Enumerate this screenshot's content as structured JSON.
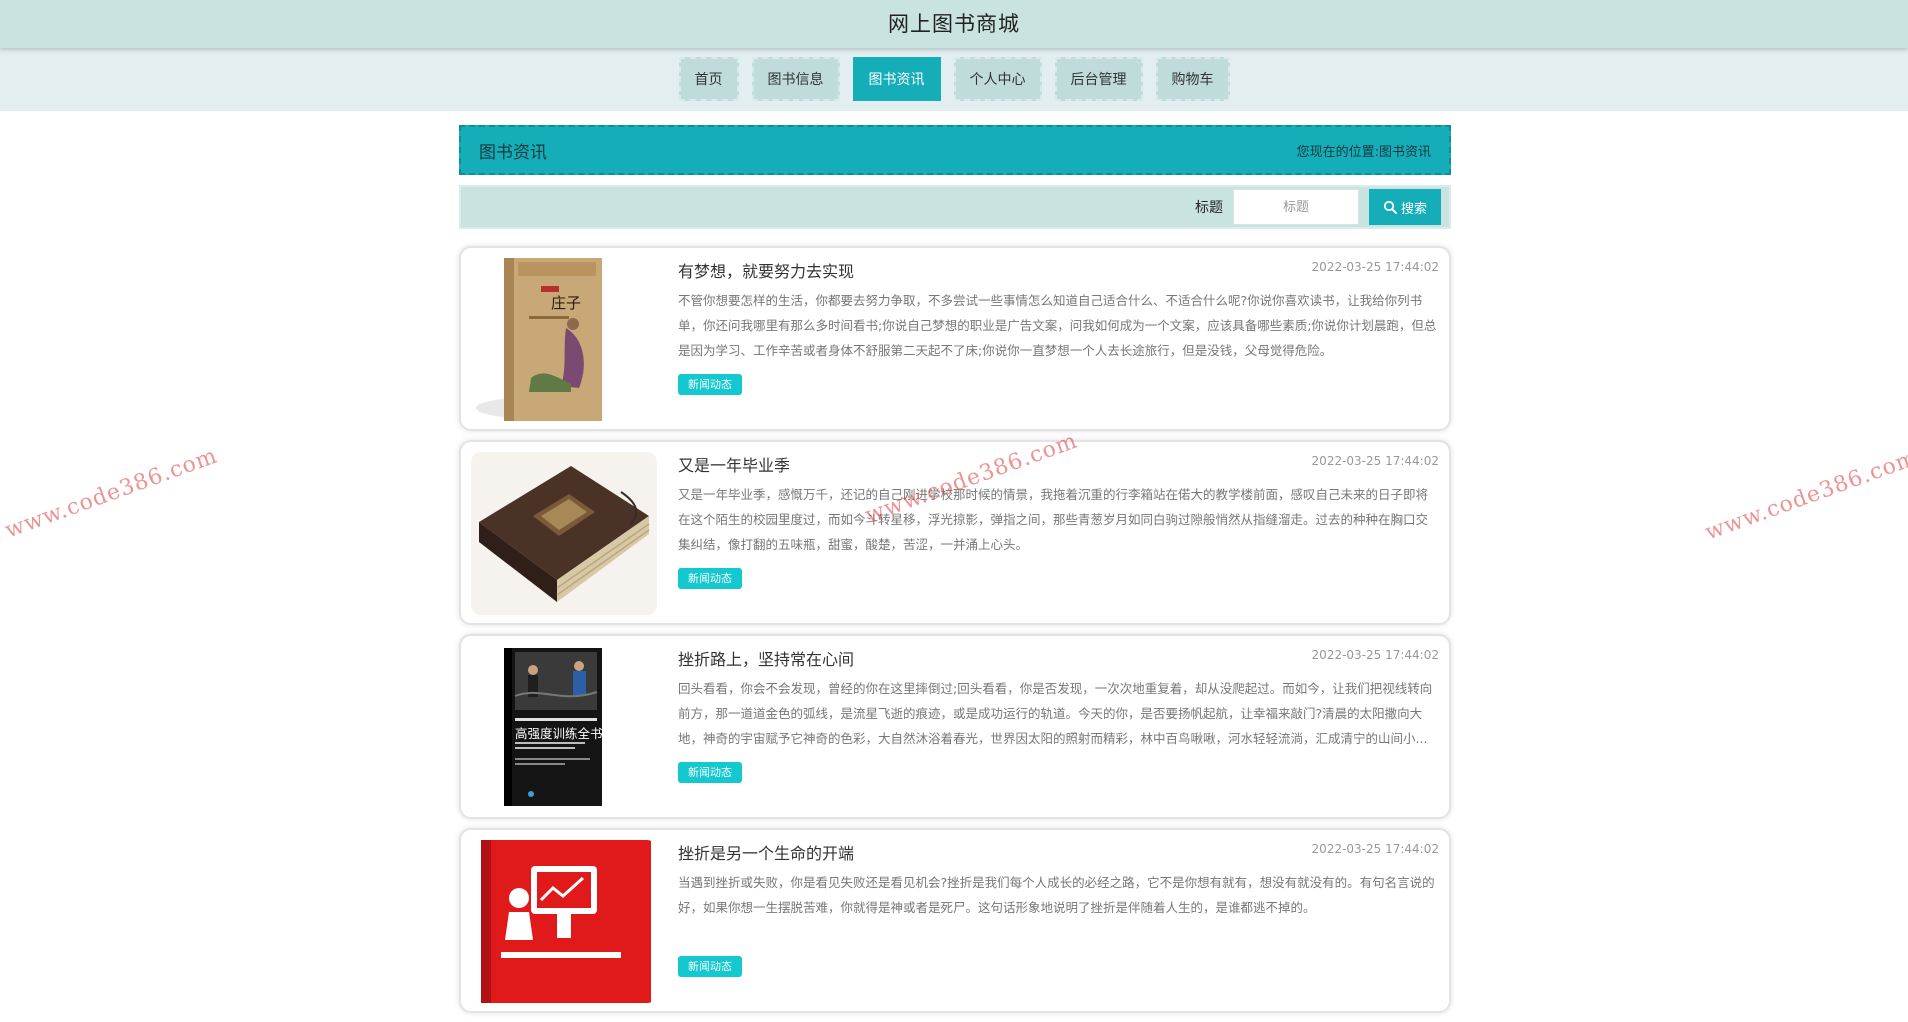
{
  "header": {
    "title": "网上图书商城"
  },
  "nav": {
    "items": [
      {
        "label": "首页"
      },
      {
        "label": "图书信息"
      },
      {
        "label": "图书资讯",
        "active": true
      },
      {
        "label": "个人中心"
      },
      {
        "label": "后台管理"
      },
      {
        "label": "购物车"
      }
    ]
  },
  "page": {
    "title": "图书资讯",
    "location_label": "您现在的位置:",
    "location_value": "图书资讯"
  },
  "search": {
    "label": "标题",
    "placeholder": "标题",
    "value": "",
    "button_label": "搜索",
    "button_icon": "search-icon"
  },
  "news": [
    {
      "title": "有梦想，就要努力去实现",
      "time": "2022-03-25 17:44:02",
      "summary": "不管你想要怎样的生活，你都要去努力争取，不多尝试一些事情怎么知道自己适合什么、不适合什么呢?你说你喜欢读书，让我给你列书单，你还问我哪里有那么多时间看书;你说自己梦想的职业是广告文案，问我如何成为一个文案，应该具备哪些素质;你说你计划晨跑，但总是因为学习、工作辛苦或者身体不舒服第二天起不了床;你说你一直梦想一个人去长途旅行，但是没钱，父母觉得危险。",
      "tag": "新闻动态",
      "image_label": "庄子"
    },
    {
      "title": "又是一年毕业季",
      "time": "2022-03-25 17:44:02",
      "summary": "又是一年毕业季，感慨万千，还记的自己刚进学校那时候的情景，我拖着沉重的行李箱站在偌大的教学楼前面，感叹自己未来的日子即将在这个陌生的校园里度过，而如今斗转星移，浮光掠影，弹指之间，那些青葱岁月如同白驹过隙般悄然从指缝溜走。过去的种种在胸口交集纠结，像打翻的五味瓶，甜蜜，酸楚，苦涩，一并涌上心头。",
      "tag": "新闻动态",
      "image_label": ""
    },
    {
      "title": "挫折路上，坚持常在心间",
      "time": "2022-03-25 17:44:02",
      "summary": "回头看看，你会不会发现，曾经的你在这里摔倒过;回头看看，你是否发现，一次次地重复着，却从没爬起过。而如今，让我们把视线转向前方，那一道道金色的弧线，是流星飞逝的痕迹，或是成功运行的轨道。今天的你，是否要扬帆起航，让幸福来敲门?清晨的太阳撒向大地，神奇的宇宙赋予它神奇的色彩，大自然沐浴着春光，世界因太阳的照射而精彩，林中百鸟啾啾，河水轻轻流淌，汇成清宁的山间小...",
      "tag": "新闻动态",
      "image_label": "高强度训练全书"
    },
    {
      "title": "挫折是另一个生命的开端",
      "time": "2022-03-25 17:44:02",
      "summary": "当遇到挫折或失败，你是看见失败还是看见机会?挫折是我们每个人成长的必经之路，它不是你想有就有，想没有就没有的。有句名言说的好，如果你想一生摆脱苦难，你就得是神或者是死尸。这句话形象地说明了挫折是伴随着人生的，是谁都逃不掉的。",
      "tag": "新闻动态",
      "image_label": ""
    }
  ],
  "watermark": "www.code386.com",
  "colors": {
    "accent": "#14adb8",
    "tag": "#14c8cf",
    "topbar": "#c9e3e0",
    "navband": "#e2eef0"
  }
}
